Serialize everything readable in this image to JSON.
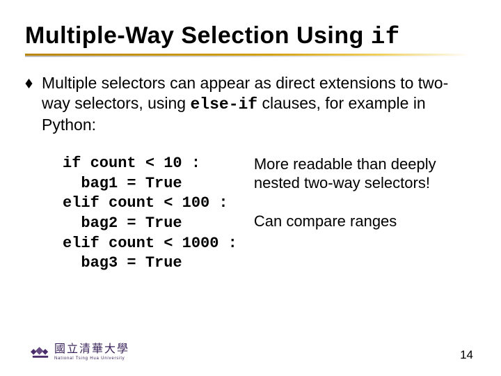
{
  "title": {
    "main": "Multiple-Way Selection Using ",
    "keyword": "if"
  },
  "bullet": {
    "pre": "Multiple selectors can appear as direct extensions to two-way selectors, using ",
    "kw": "else-if",
    "post": " clauses, for example in Python:"
  },
  "code": "if count < 10 :\n  bag1 = True\nelif count < 100 :\n  bag2 = True\nelif count < 1000 :\n  bag3 = True",
  "notes": {
    "p1": "More readable than deeply nested two-way selectors!",
    "p2": "Can compare ranges"
  },
  "footer": {
    "cn": "國立清華大學",
    "en": "National Tsing Hua University"
  },
  "pagenum": "14"
}
